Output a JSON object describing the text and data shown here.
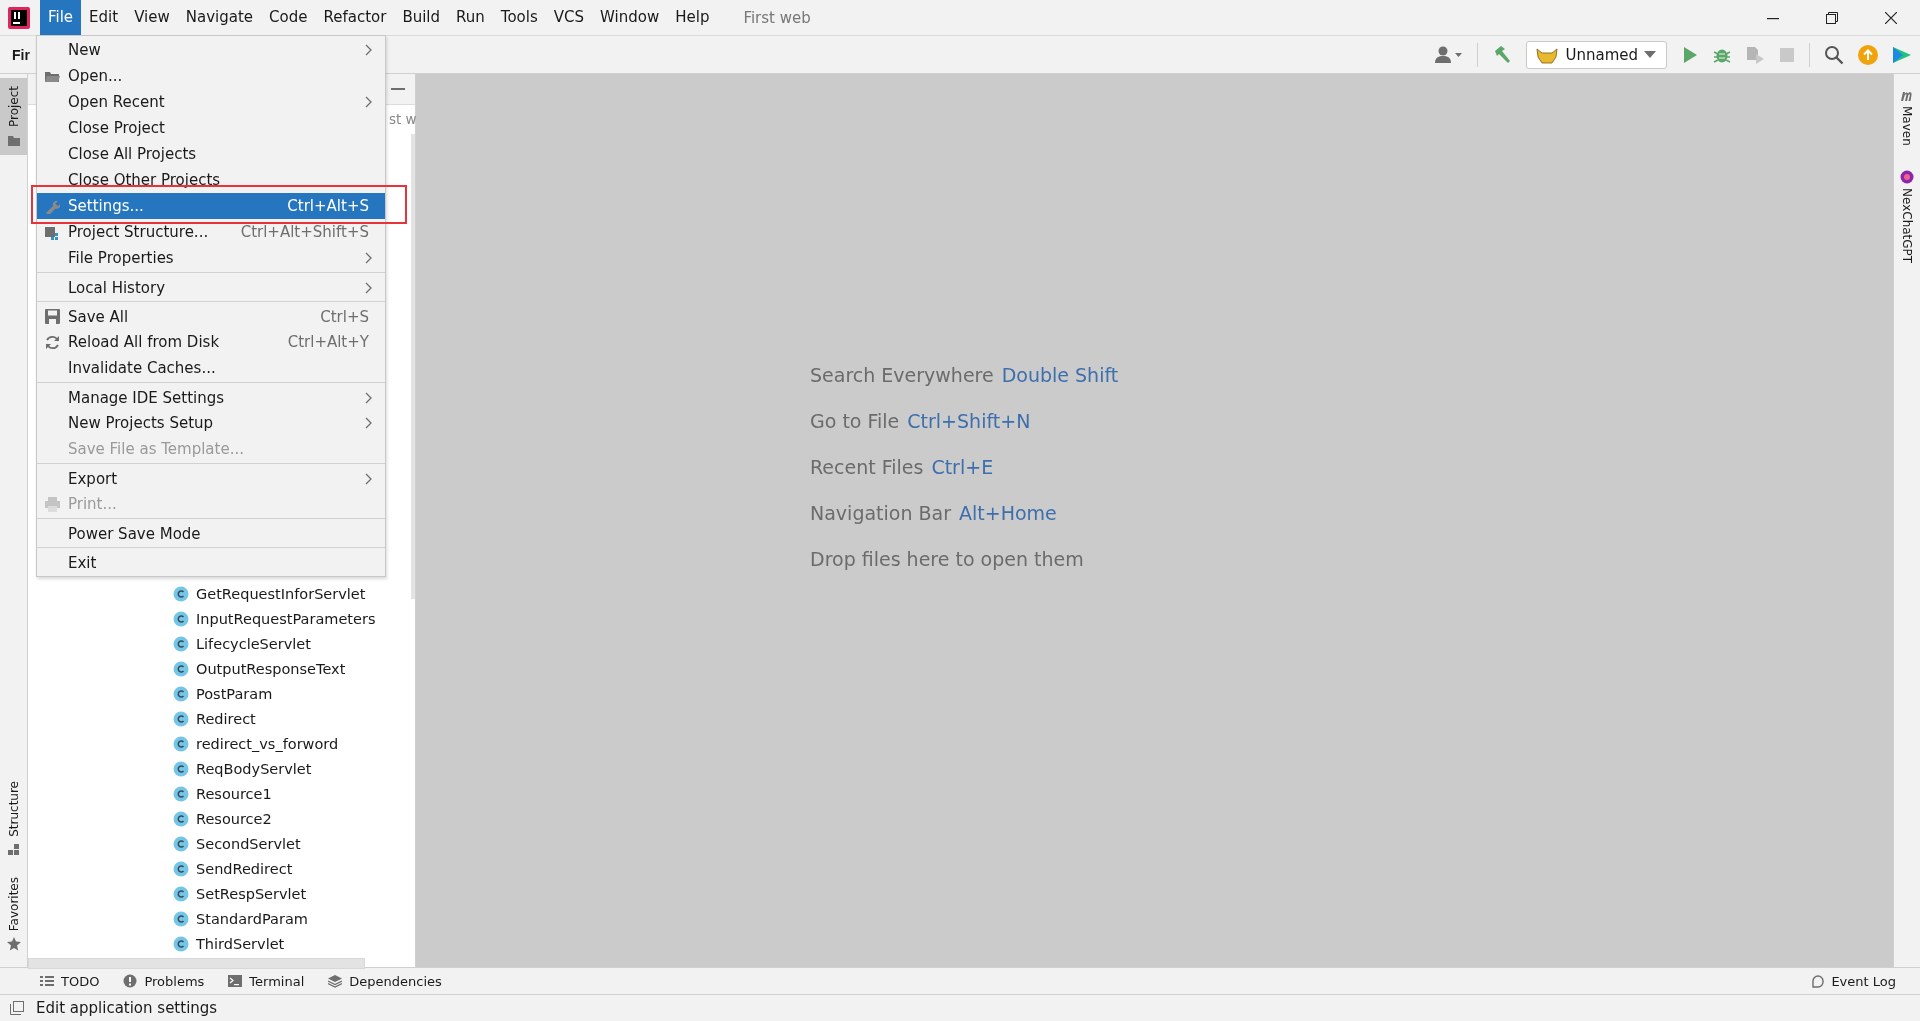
{
  "menu_bar": {
    "items": [
      {
        "label": "File",
        "selected": true
      },
      {
        "label": "Edit",
        "selected": false
      },
      {
        "label": "View",
        "selected": false
      },
      {
        "label": "Navigate",
        "selected": false
      },
      {
        "label": "Code",
        "selected": false
      },
      {
        "label": "Refactor",
        "selected": false
      },
      {
        "label": "Build",
        "selected": false
      },
      {
        "label": "Run",
        "selected": false
      },
      {
        "label": "Tools",
        "selected": false
      },
      {
        "label": "VCS",
        "selected": false
      },
      {
        "label": "Window",
        "selected": false
      },
      {
        "label": "Help",
        "selected": false
      }
    ],
    "title": "First web"
  },
  "toolbar": {
    "project_title": "Fir",
    "run_config": "Unnamed"
  },
  "left_strip": [
    {
      "label": "Project",
      "selected": true
    },
    {
      "label": "Structure",
      "selected": false
    },
    {
      "label": "Favorites",
      "selected": false
    }
  ],
  "right_strip": [
    {
      "label": "Maven"
    },
    {
      "label": "NexChatGPT"
    }
  ],
  "project_tree": {
    "fragment": "st w",
    "items": [
      {
        "label": "GetRequestInforServlet"
      },
      {
        "label": "InputRequestParameters"
      },
      {
        "label": "LifecycleServlet"
      },
      {
        "label": "OutputResponseText"
      },
      {
        "label": "PostParam"
      },
      {
        "label": "Redirect"
      },
      {
        "label": "redirect_vs_forword"
      },
      {
        "label": "ReqBodyServlet"
      },
      {
        "label": "Resource1"
      },
      {
        "label": "Resource2"
      },
      {
        "label": "SecondServlet"
      },
      {
        "label": "SendRedirect"
      },
      {
        "label": "SetRespServlet"
      },
      {
        "label": "StandardParam"
      },
      {
        "label": "ThirdServlet"
      }
    ]
  },
  "editor": {
    "hints": [
      {
        "text": "Search Everywhere",
        "shortcut": "Double Shift"
      },
      {
        "text": "Go to File",
        "shortcut": "Ctrl+Shift+N"
      },
      {
        "text": "Recent Files",
        "shortcut": "Ctrl+E"
      },
      {
        "text": "Navigation Bar",
        "shortcut": "Alt+Home"
      },
      {
        "text": "Drop files here to open them"
      }
    ]
  },
  "file_menu": {
    "items": [
      {
        "label": "New",
        "submenu": true,
        "disabled": false,
        "selected": false,
        "outlined": false,
        "separator_before": false
      },
      {
        "label": "Open...",
        "submenu": false,
        "disabled": false,
        "selected": false,
        "outlined": false,
        "separator_before": false
      },
      {
        "label": "Open Recent",
        "submenu": true,
        "disabled": false,
        "selected": false,
        "outlined": false,
        "separator_before": false
      },
      {
        "label": "Close Project",
        "submenu": false,
        "disabled": false,
        "selected": false,
        "outlined": false,
        "separator_before": false
      },
      {
        "label": "Close All Projects",
        "submenu": false,
        "disabled": false,
        "selected": false,
        "outlined": false,
        "separator_before": false
      },
      {
        "label": "Close Other Projects",
        "submenu": false,
        "disabled": false,
        "selected": false,
        "outlined": false,
        "separator_before": false
      },
      {
        "label": "Settings...",
        "shortcut": "Ctrl+Alt+S",
        "submenu": false,
        "disabled": false,
        "selected": true,
        "outlined": true,
        "separator_before": false
      },
      {
        "label": "Project Structure...",
        "shortcut": "Ctrl+Alt+Shift+S",
        "submenu": false,
        "disabled": false,
        "selected": false,
        "outlined": false,
        "separator_before": false
      },
      {
        "label": "File Properties",
        "submenu": true,
        "disabled": false,
        "selected": false,
        "outlined": false,
        "separator_before": false
      },
      {
        "label": "Local History",
        "submenu": true,
        "disabled": false,
        "selected": false,
        "outlined": false,
        "separator_before": true
      },
      {
        "label": "Save All",
        "shortcut": "Ctrl+S",
        "submenu": false,
        "disabled": false,
        "selected": false,
        "outlined": false,
        "separator_before": true
      },
      {
        "label": "Reload All from Disk",
        "shortcut": "Ctrl+Alt+Y",
        "submenu": false,
        "disabled": false,
        "selected": false,
        "outlined": false,
        "separator_before": false
      },
      {
        "label": "Invalidate Caches...",
        "submenu": false,
        "disabled": false,
        "selected": false,
        "outlined": false,
        "separator_before": false
      },
      {
        "label": "Manage IDE Settings",
        "submenu": true,
        "disabled": false,
        "selected": false,
        "outlined": false,
        "separator_before": true
      },
      {
        "label": "New Projects Setup",
        "submenu": true,
        "disabled": false,
        "selected": false,
        "outlined": false,
        "separator_before": false
      },
      {
        "label": "Save File as Template...",
        "submenu": false,
        "disabled": true,
        "selected": false,
        "outlined": false,
        "separator_before": false
      },
      {
        "label": "Export",
        "submenu": true,
        "disabled": false,
        "selected": false,
        "outlined": false,
        "separator_before": true
      },
      {
        "label": "Print...",
        "submenu": false,
        "disabled": true,
        "selected": false,
        "outlined": false,
        "separator_before": false
      },
      {
        "label": "Power Save Mode",
        "submenu": false,
        "disabled": false,
        "selected": false,
        "outlined": false,
        "separator_before": true
      },
      {
        "label": "Exit",
        "submenu": false,
        "disabled": false,
        "selected": false,
        "outlined": false,
        "separator_before": true
      }
    ]
  },
  "bottom_tabs": {
    "items": [
      {
        "label": "TODO"
      },
      {
        "label": "Problems"
      },
      {
        "label": "Terminal"
      },
      {
        "label": "Dependencies"
      }
    ],
    "event_log": "Event Log"
  },
  "status_bar": {
    "text": "Edit application settings"
  }
}
